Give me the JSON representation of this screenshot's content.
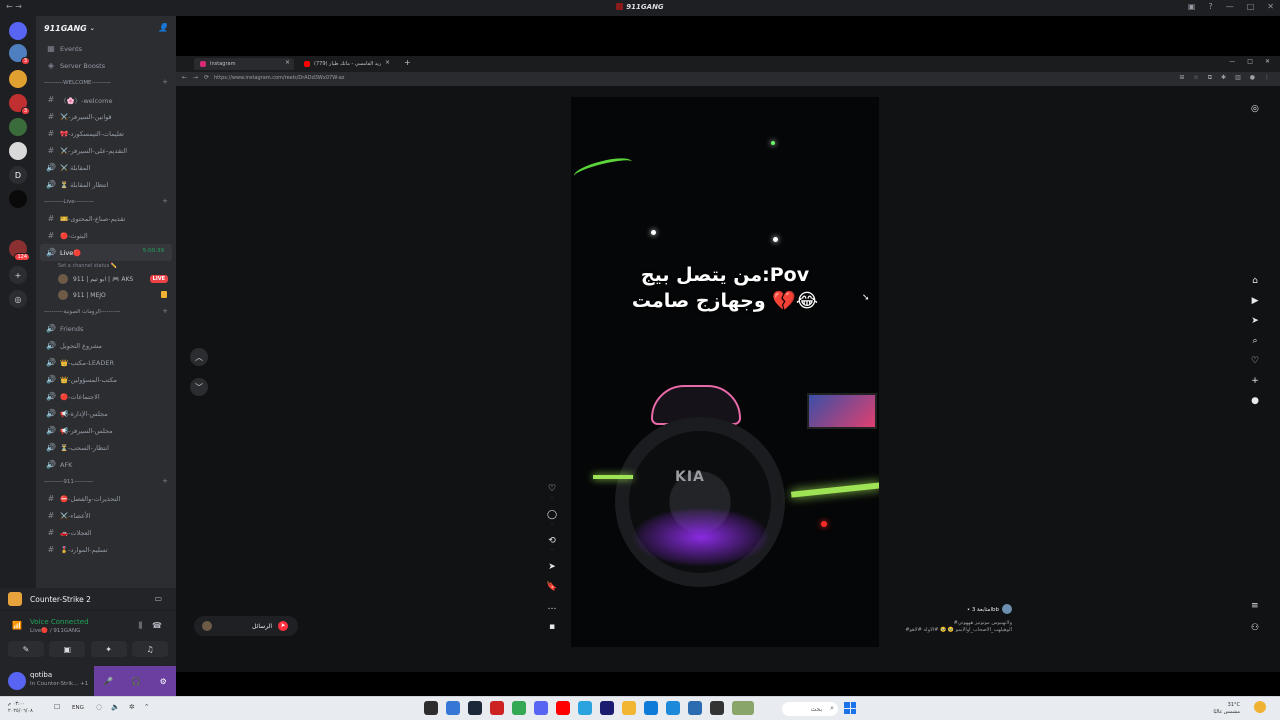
{
  "window": {
    "title": "911GANG"
  },
  "rail": {
    "servers": [
      {
        "icon": "discord-home-icon",
        "color": "#5865f2",
        "badge": ""
      },
      {
        "icon": "server-avatar-1",
        "color": "#4f7fbf",
        "badge": "3"
      },
      {
        "icon": "server-avatar-2",
        "color": "#e0a030",
        "badge": ""
      },
      {
        "icon": "server-avatar-3",
        "color": "#c03030",
        "badge": "3"
      },
      {
        "icon": "server-avatar-4",
        "color": "#3a6b3a",
        "badge": ""
      },
      {
        "icon": "server-avatar-5",
        "color": "#d9d9d9",
        "badge": ""
      },
      {
        "icon": "server-letter-d",
        "color": "#2b2d31",
        "badge": "",
        "label": "D"
      },
      {
        "icon": "server-avatar-6",
        "color": "#0a0a0a",
        "badge": ""
      },
      {
        "icon": "server-avatar-7",
        "color": "#8a3030",
        "badge": "124"
      }
    ]
  },
  "sidebar": {
    "guild_name": "911GANG",
    "top_items": [
      {
        "icon": "calendar-icon",
        "label": "Events"
      },
      {
        "icon": "boost-icon",
        "label": "Server Boosts"
      }
    ],
    "categories": [
      {
        "label": "—-------WELCOME-------—",
        "channels": [
          {
            "type": "text",
            "label": "〈🌸〉-welcome"
          },
          {
            "type": "text",
            "label": "⚔️-قوانين-السيرفر"
          },
          {
            "type": "text",
            "label": "🎀-تعليمات-التيمسكورد"
          },
          {
            "type": "text",
            "label": "⚔️-التقديم-على-السيرفر"
          },
          {
            "type": "voice",
            "label": "⚔️ المقابلة"
          },
          {
            "type": "voice",
            "label": "⏳ انتظار المقابلة"
          }
        ]
      },
      {
        "label": "—-------Live-------—",
        "channels": [
          {
            "type": "text",
            "label": "🎫-تقديم-صناع-المحتوى"
          },
          {
            "type": "text",
            "label": "🔴-البثوث"
          }
        ]
      }
    ],
    "live_channel": {
      "label": "Live🔴",
      "timer": "5:00:39",
      "status": "Set a channel status ✏️",
      "members": [
        {
          "name": "911 | ابو تيم | 🎮 AKS",
          "badge": "LIVE"
        },
        {
          "name": "911 | MEJO",
          "badge": ""
        }
      ]
    },
    "categories_after": [
      {
        "label": "—-------الرومات الصوتية-------—",
        "channels": [
          {
            "type": "voice",
            "label": "Friends"
          },
          {
            "type": "voice",
            "label": "مشروع التحويل"
          },
          {
            "type": "voice",
            "label": "👑-مكتب-LEADER"
          },
          {
            "type": "voice",
            "label": "👑-مكتب-المسؤولين"
          },
          {
            "type": "voice",
            "label": "🔴-الاجتماعات"
          },
          {
            "type": "voice",
            "label": "📢-مجلس-الإدارة"
          },
          {
            "type": "voice",
            "label": "📢-مجلس-السيرفر"
          },
          {
            "type": "voice",
            "label": "⏳-انتظار-السحب"
          },
          {
            "type": "voice",
            "label": "AFK"
          }
        ]
      },
      {
        "label": "—-------911-------—",
        "channels": [
          {
            "type": "text",
            "label": "⛔-التحذيرات-والفصل"
          },
          {
            "type": "text",
            "label": "⚔️-الأعضاء"
          },
          {
            "type": "text",
            "label": "🚗-العجلات"
          },
          {
            "type": "text",
            "label": "🎖️-تسليم-الموارد"
          }
        ]
      }
    ]
  },
  "activity": {
    "game": "Counter-Strike 2"
  },
  "voice": {
    "status": "Voice Connected",
    "location": "Live🔴 / 911GANG"
  },
  "user": {
    "name": "qotiba",
    "status": "In Counter-Strik... +1"
  },
  "stream": {
    "tabs": [
      {
        "label": "Instagram",
        "active": true
      },
      {
        "label": "(779) ريد الفامسي - ماتك طيار",
        "active": false
      }
    ],
    "url": "https://www.instagram.com/reels/DrADd3Wx07W-az",
    "caption_line1": "من يتصل بيج:Pov",
    "caption_line2": "وجهازج صامت 💔😂",
    "car_logo": "KIA",
    "messages_label": "الرسائل",
    "author": "• متابعة 3lbb",
    "description": "#ولاتهيبوس موتوتيز هههوتي\n#الوهيلهب_الاصحاب_اوالايمو 🥹 🥹 #الاولة #لاهو"
  },
  "taskbar": {
    "lang": "ENG",
    "time": "٠٣:٠٠ م",
    "date": "٢٠٢٥/٠٦/٠٨",
    "search_label": "بحث",
    "weather_temp": "31°C",
    "weather_desc": "مشمس غالبًا"
  }
}
